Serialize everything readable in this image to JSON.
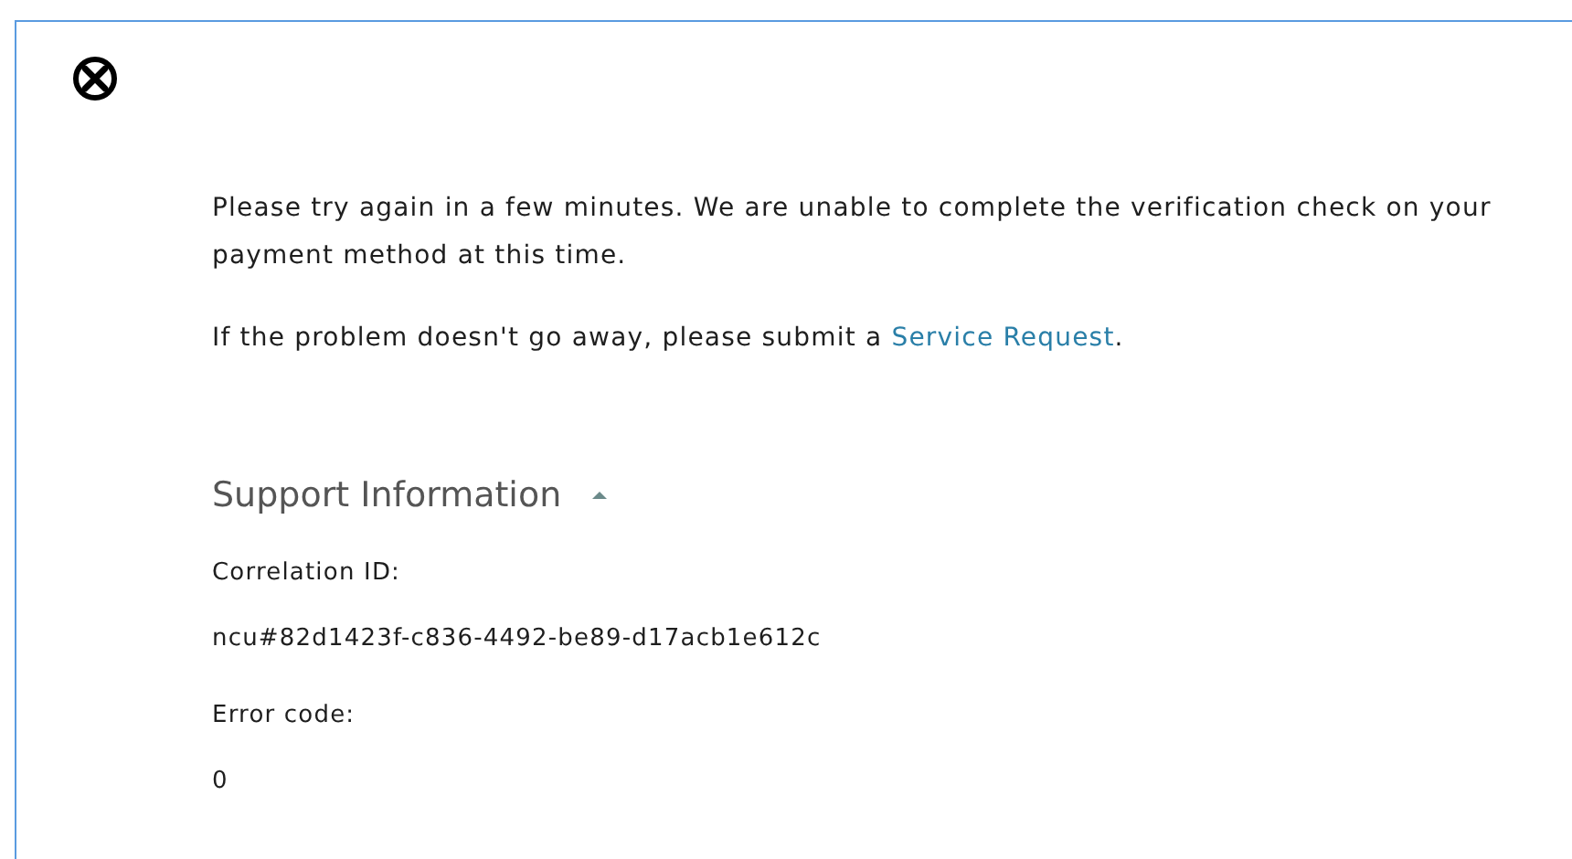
{
  "status_icon": {
    "kind": "error"
  },
  "message": "Please try again in a few minutes. We are unable to complete the verification check on your payment method at this time.",
  "followup": {
    "before": "If the problem doesn't go away, please submit a ",
    "link": "Service Request",
    "after": "."
  },
  "support": {
    "title": "Support Information",
    "expanded": true,
    "fields": [
      {
        "label": "Correlation ID:",
        "value": "ncu#82d1423f-c836-4492-be89-d17acb1e612c"
      },
      {
        "label": "Error code:",
        "value": "0"
      }
    ]
  }
}
